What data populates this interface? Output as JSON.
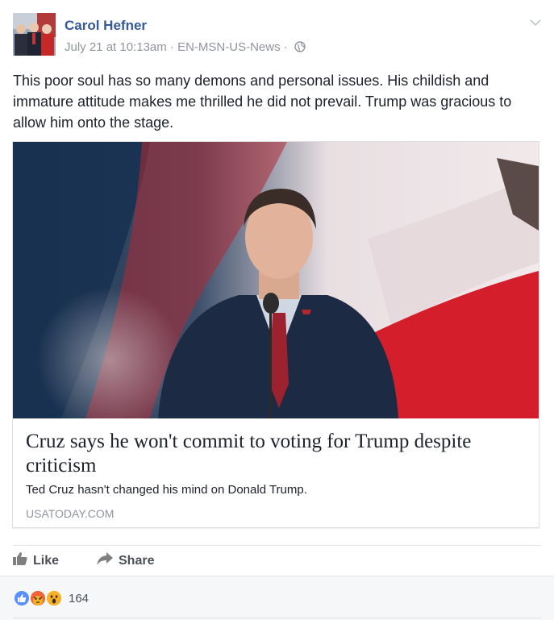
{
  "post": {
    "author": "Carol Hefner",
    "date": "July 21 at 10:13am",
    "source": "EN-MSN-US-News",
    "separator": "·",
    "privacy_icon": "globe-icon",
    "menu_icon": "chevron-down-icon",
    "text": "This poor soul has so many demons and personal issues. His childish and immature attitude makes me thrilled he did not prevail. Trump was gracious to allow him onto the stage."
  },
  "link_card": {
    "title": "Cruz says he won't commit to voting for Trump despite criticism",
    "description": "Ted Cruz hasn't changed his mind on Donald Trump.",
    "domain": "USATODAY.COM"
  },
  "actions": {
    "like_label": "Like",
    "share_label": "Share"
  },
  "reactions": {
    "icons": [
      "like-icon",
      "angry-icon",
      "wow-icon"
    ],
    "count": "164"
  },
  "colors": {
    "name_link": "#365899",
    "meta_gray": "#90949c",
    "like_blue": "#4267b2",
    "reaction_bar_bg": "#f6f7f9"
  }
}
